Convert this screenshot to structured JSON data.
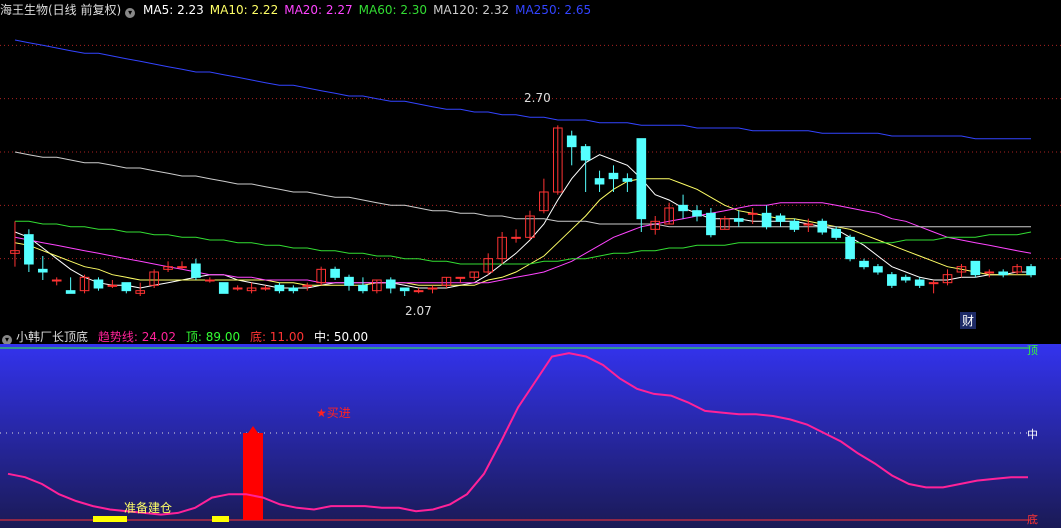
{
  "upper_panel": {
    "stock_name": "海王生物(日线 前复权)",
    "ma": [
      {
        "label": "MA5: 2.23",
        "color": "#ffffff"
      },
      {
        "label": "MA10: 2.22",
        "color": "#ffff66"
      },
      {
        "label": "MA20: 2.27",
        "color": "#ff44ff"
      },
      {
        "label": "MA60: 2.30",
        "color": "#33dd33"
      },
      {
        "label": "MA120: 2.32",
        "color": "#cccccc"
      },
      {
        "label": "MA250: 2.65",
        "color": "#3344ff"
      }
    ],
    "high_label": "2.70",
    "low_label": "2.07",
    "finance_badge": "财"
  },
  "lower_panel": {
    "indicator_name": "小韩厂长顶底",
    "trend_label": "趋势线: 24.02",
    "top_label": "顶: 89.00",
    "bottom_label": "底: 11.00",
    "mid_label": "中: 50.00",
    "axis_top": "顶",
    "axis_mid": "中",
    "axis_bottom": "底",
    "buy_signal": "★买进",
    "prepare_signal": "准备建仓"
  },
  "colors": {
    "up_candle": "#ff3333",
    "down_candle": "#55ffff",
    "grid": "#aa2222",
    "trend_line": "#ff2299",
    "indicator_bg_top": "#3333ee",
    "indicator_bg_bottom": "#1a1a55",
    "buy_bar": "#ff0000",
    "prepare_bar": "#ffff00"
  },
  "chart_data": [
    {
      "type": "candlestick",
      "candles": [
        [
          2.22,
          2.34,
          2.23,
          2.17
        ],
        [
          2.29,
          2.31,
          2.18,
          2.15
        ],
        [
          2.16,
          2.21,
          2.15,
          2.12
        ],
        [
          2.12,
          2.13,
          2.12,
          2.1
        ],
        [
          2.08,
          2.13,
          2.07,
          2.07
        ],
        [
          2.08,
          2.14,
          2.13,
          2.07
        ],
        [
          2.12,
          2.13,
          2.09,
          2.08
        ],
        [
          2.1,
          2.12,
          2.1,
          2.09
        ],
        [
          2.11,
          2.11,
          2.08,
          2.07
        ],
        [
          2.07,
          2.11,
          2.08,
          2.06
        ],
        [
          2.1,
          2.16,
          2.15,
          2.09
        ],
        [
          2.16,
          2.19,
          2.17,
          2.15
        ],
        [
          2.17,
          2.19,
          2.17,
          2.16
        ],
        [
          2.18,
          2.2,
          2.13,
          2.12
        ],
        [
          2.12,
          2.13,
          2.12,
          2.11
        ],
        [
          2.11,
          2.11,
          2.07,
          2.07
        ],
        [
          2.09,
          2.1,
          2.09,
          2.08
        ],
        [
          2.08,
          2.11,
          2.09,
          2.07
        ],
        [
          2.09,
          2.1,
          2.09,
          2.08
        ],
        [
          2.1,
          2.11,
          2.08,
          2.07
        ],
        [
          2.09,
          2.1,
          2.08,
          2.07
        ],
        [
          2.1,
          2.11,
          2.1,
          2.08
        ],
        [
          2.11,
          2.17,
          2.16,
          2.1
        ],
        [
          2.16,
          2.17,
          2.13,
          2.12
        ],
        [
          2.13,
          2.14,
          2.1,
          2.08
        ],
        [
          2.1,
          2.13,
          2.08,
          2.07
        ],
        [
          2.08,
          2.12,
          2.12,
          2.07
        ],
        [
          2.12,
          2.13,
          2.09,
          2.07
        ],
        [
          2.09,
          2.09,
          2.08,
          2.06
        ],
        [
          2.08,
          2.09,
          2.08,
          2.07
        ],
        [
          2.09,
          2.1,
          2.09,
          2.07
        ],
        [
          2.1,
          2.13,
          2.13,
          2.09
        ],
        [
          2.13,
          2.13,
          2.13,
          2.11
        ],
        [
          2.13,
          2.15,
          2.15,
          2.12
        ],
        [
          2.15,
          2.22,
          2.2,
          2.14
        ],
        [
          2.2,
          2.3,
          2.28,
          2.18
        ],
        [
          2.28,
          2.31,
          2.28,
          2.26
        ],
        [
          2.28,
          2.38,
          2.36,
          2.27
        ],
        [
          2.38,
          2.5,
          2.45,
          2.37
        ],
        [
          2.45,
          2.7,
          2.69,
          2.44
        ],
        [
          2.66,
          2.68,
          2.62,
          2.55
        ],
        [
          2.62,
          2.63,
          2.57,
          2.45
        ],
        [
          2.5,
          2.53,
          2.48,
          2.45
        ],
        [
          2.52,
          2.55,
          2.5,
          2.45
        ],
        [
          2.5,
          2.52,
          2.49,
          2.45
        ],
        [
          2.65,
          2.65,
          2.35,
          2.3
        ],
        [
          2.31,
          2.36,
          2.34,
          2.29
        ],
        [
          2.33,
          2.41,
          2.39,
          2.33
        ],
        [
          2.4,
          2.44,
          2.38,
          2.35
        ],
        [
          2.38,
          2.4,
          2.36,
          2.34
        ],
        [
          2.37,
          2.39,
          2.29,
          2.28
        ],
        [
          2.31,
          2.36,
          2.35,
          2.31
        ],
        [
          2.35,
          2.38,
          2.34,
          2.32
        ],
        [
          2.37,
          2.39,
          2.37,
          2.33
        ],
        [
          2.37,
          2.4,
          2.32,
          2.31
        ],
        [
          2.36,
          2.37,
          2.34,
          2.32
        ],
        [
          2.34,
          2.35,
          2.31,
          2.3
        ],
        [
          2.33,
          2.35,
          2.33,
          2.3
        ],
        [
          2.34,
          2.35,
          2.3,
          2.29
        ],
        [
          2.31,
          2.32,
          2.28,
          2.27
        ],
        [
          2.28,
          2.29,
          2.2,
          2.19
        ],
        [
          2.19,
          2.2,
          2.17,
          2.16
        ],
        [
          2.17,
          2.18,
          2.15,
          2.14
        ],
        [
          2.14,
          2.15,
          2.1,
          2.09
        ],
        [
          2.13,
          2.14,
          2.12,
          2.11
        ],
        [
          2.12,
          2.13,
          2.1,
          2.09
        ],
        [
          2.11,
          2.12,
          2.11,
          2.07
        ],
        [
          2.11,
          2.16,
          2.14,
          2.1
        ],
        [
          2.15,
          2.18,
          2.17,
          2.13
        ],
        [
          2.19,
          2.19,
          2.14,
          2.13
        ],
        [
          2.15,
          2.16,
          2.15,
          2.13
        ],
        [
          2.15,
          2.16,
          2.14,
          2.13
        ],
        [
          2.15,
          2.18,
          2.17,
          2.14
        ],
        [
          2.17,
          2.18,
          2.14,
          2.13
        ]
      ],
      "ma_series": [
        {
          "name": "MA5",
          "color": "#ffffff",
          "values": [
            2.3,
            2.28,
            2.24,
            2.2,
            2.16,
            2.13,
            2.11,
            2.1,
            2.1,
            2.09,
            2.1,
            2.11,
            2.12,
            2.13,
            2.14,
            2.14,
            2.12,
            2.11,
            2.1,
            2.09,
            2.09,
            2.09,
            2.1,
            2.11,
            2.11,
            2.11,
            2.11,
            2.11,
            2.1,
            2.09,
            2.09,
            2.09,
            2.1,
            2.11,
            2.14,
            2.18,
            2.22,
            2.27,
            2.33,
            2.42,
            2.5,
            2.56,
            2.59,
            2.57,
            2.55,
            2.5,
            2.44,
            2.42,
            2.39,
            2.37,
            2.35,
            2.35,
            2.35,
            2.34,
            2.34,
            2.34,
            2.34,
            2.33,
            2.32,
            2.31,
            2.28,
            2.25,
            2.21,
            2.17,
            2.15,
            2.13,
            2.12,
            2.12,
            2.13,
            2.13,
            2.14,
            2.14,
            2.15,
            2.15
          ]
        },
        {
          "name": "MA10",
          "color": "#ffff66",
          "values": [
            2.26,
            2.25,
            2.23,
            2.21,
            2.19,
            2.17,
            2.16,
            2.14,
            2.13,
            2.12,
            2.12,
            2.12,
            2.12,
            2.12,
            2.12,
            2.12,
            2.12,
            2.12,
            2.12,
            2.11,
            2.11,
            2.1,
            2.1,
            2.1,
            2.1,
            2.1,
            2.11,
            2.11,
            2.11,
            2.1,
            2.1,
            2.1,
            2.1,
            2.1,
            2.12,
            2.13,
            2.15,
            2.18,
            2.21,
            2.26,
            2.31,
            2.36,
            2.42,
            2.46,
            2.49,
            2.5,
            2.5,
            2.5,
            2.48,
            2.46,
            2.43,
            2.4,
            2.38,
            2.37,
            2.36,
            2.35,
            2.35,
            2.34,
            2.33,
            2.32,
            2.31,
            2.29,
            2.27,
            2.25,
            2.23,
            2.21,
            2.19,
            2.17,
            2.16,
            2.15,
            2.14,
            2.14,
            2.14,
            2.14
          ]
        },
        {
          "name": "MA20",
          "color": "#ff44ff",
          "values": [
            2.28,
            2.27,
            2.26,
            2.25,
            2.24,
            2.23,
            2.22,
            2.21,
            2.2,
            2.19,
            2.18,
            2.17,
            2.16,
            2.15,
            2.14,
            2.14,
            2.13,
            2.13,
            2.12,
            2.12,
            2.12,
            2.12,
            2.11,
            2.11,
            2.11,
            2.11,
            2.11,
            2.11,
            2.11,
            2.11,
            2.11,
            2.11,
            2.11,
            2.11,
            2.11,
            2.12,
            2.13,
            2.14,
            2.15,
            2.17,
            2.19,
            2.22,
            2.25,
            2.28,
            2.3,
            2.32,
            2.33,
            2.34,
            2.35,
            2.36,
            2.37,
            2.38,
            2.39,
            2.4,
            2.4,
            2.41,
            2.41,
            2.41,
            2.41,
            2.4,
            2.39,
            2.38,
            2.37,
            2.35,
            2.34,
            2.32,
            2.3,
            2.28,
            2.27,
            2.26,
            2.25,
            2.24,
            2.23,
            2.22
          ]
        },
        {
          "name": "MA60",
          "color": "#33dd33",
          "values": [
            2.34,
            2.34,
            2.33,
            2.33,
            2.32,
            2.32,
            2.31,
            2.31,
            2.3,
            2.3,
            2.29,
            2.29,
            2.28,
            2.28,
            2.27,
            2.27,
            2.26,
            2.26,
            2.25,
            2.25,
            2.24,
            2.24,
            2.23,
            2.23,
            2.22,
            2.22,
            2.21,
            2.21,
            2.2,
            2.2,
            2.19,
            2.19,
            2.18,
            2.18,
            2.18,
            2.18,
            2.18,
            2.18,
            2.19,
            2.19,
            2.2,
            2.2,
            2.21,
            2.22,
            2.22,
            2.23,
            2.23,
            2.24,
            2.24,
            2.25,
            2.25,
            2.25,
            2.26,
            2.26,
            2.26,
            2.26,
            2.26,
            2.26,
            2.26,
            2.26,
            2.26,
            2.26,
            2.26,
            2.26,
            2.27,
            2.27,
            2.27,
            2.28,
            2.28,
            2.28,
            2.29,
            2.29,
            2.29,
            2.3
          ]
        },
        {
          "name": "MA120",
          "color": "#cccccc",
          "values": [
            2.6,
            2.59,
            2.58,
            2.58,
            2.57,
            2.56,
            2.56,
            2.55,
            2.54,
            2.54,
            2.53,
            2.52,
            2.51,
            2.51,
            2.5,
            2.49,
            2.48,
            2.48,
            2.47,
            2.46,
            2.45,
            2.45,
            2.44,
            2.43,
            2.43,
            2.42,
            2.41,
            2.4,
            2.4,
            2.39,
            2.38,
            2.38,
            2.37,
            2.37,
            2.36,
            2.36,
            2.35,
            2.35,
            2.35,
            2.34,
            2.34,
            2.34,
            2.33,
            2.33,
            2.33,
            2.33,
            2.33,
            2.32,
            2.32,
            2.32,
            2.32,
            2.32,
            2.32,
            2.32,
            2.32,
            2.32,
            2.32,
            2.32,
            2.32,
            2.32,
            2.32,
            2.32,
            2.32,
            2.32,
            2.32,
            2.32,
            2.32,
            2.32,
            2.32,
            2.32,
            2.32,
            2.32,
            2.32,
            2.32
          ]
        },
        {
          "name": "MA250",
          "color": "#3344ff",
          "values": [
            3.02,
            3.01,
            3.0,
            2.99,
            2.98,
            2.97,
            2.97,
            2.96,
            2.95,
            2.94,
            2.93,
            2.92,
            2.91,
            2.9,
            2.9,
            2.89,
            2.88,
            2.87,
            2.86,
            2.85,
            2.85,
            2.84,
            2.83,
            2.82,
            2.81,
            2.81,
            2.8,
            2.79,
            2.79,
            2.78,
            2.77,
            2.76,
            2.76,
            2.75,
            2.75,
            2.74,
            2.74,
            2.73,
            2.73,
            2.72,
            2.72,
            2.72,
            2.71,
            2.71,
            2.71,
            2.7,
            2.7,
            2.7,
            2.7,
            2.69,
            2.69,
            2.69,
            2.69,
            2.68,
            2.68,
            2.68,
            2.68,
            2.68,
            2.67,
            2.67,
            2.67,
            2.67,
            2.67,
            2.66,
            2.66,
            2.66,
            2.66,
            2.66,
            2.66,
            2.65,
            2.65,
            2.65,
            2.65,
            2.65
          ]
        }
      ]
    },
    {
      "type": "line",
      "ylim": [
        0,
        100
      ],
      "trend": [
        26,
        24,
        20,
        14,
        10,
        7,
        5,
        4,
        3,
        2,
        3,
        6,
        12,
        14,
        14,
        12,
        8,
        6,
        5,
        7,
        7,
        7,
        6,
        6,
        4,
        5,
        8,
        14,
        26,
        45,
        65,
        80,
        95,
        97,
        95,
        90,
        82,
        76,
        73,
        72,
        68,
        63,
        62,
        61,
        61,
        60,
        58,
        55,
        50,
        45,
        38,
        32,
        25,
        20,
        18,
        18,
        20,
        22,
        23,
        24,
        24
      ],
      "mid": 50,
      "buy_signal_index": 14,
      "buy_value": 50,
      "prepare_zone": [
        5,
        7
      ],
      "prepare_zone2": [
        12,
        13
      ]
    }
  ]
}
